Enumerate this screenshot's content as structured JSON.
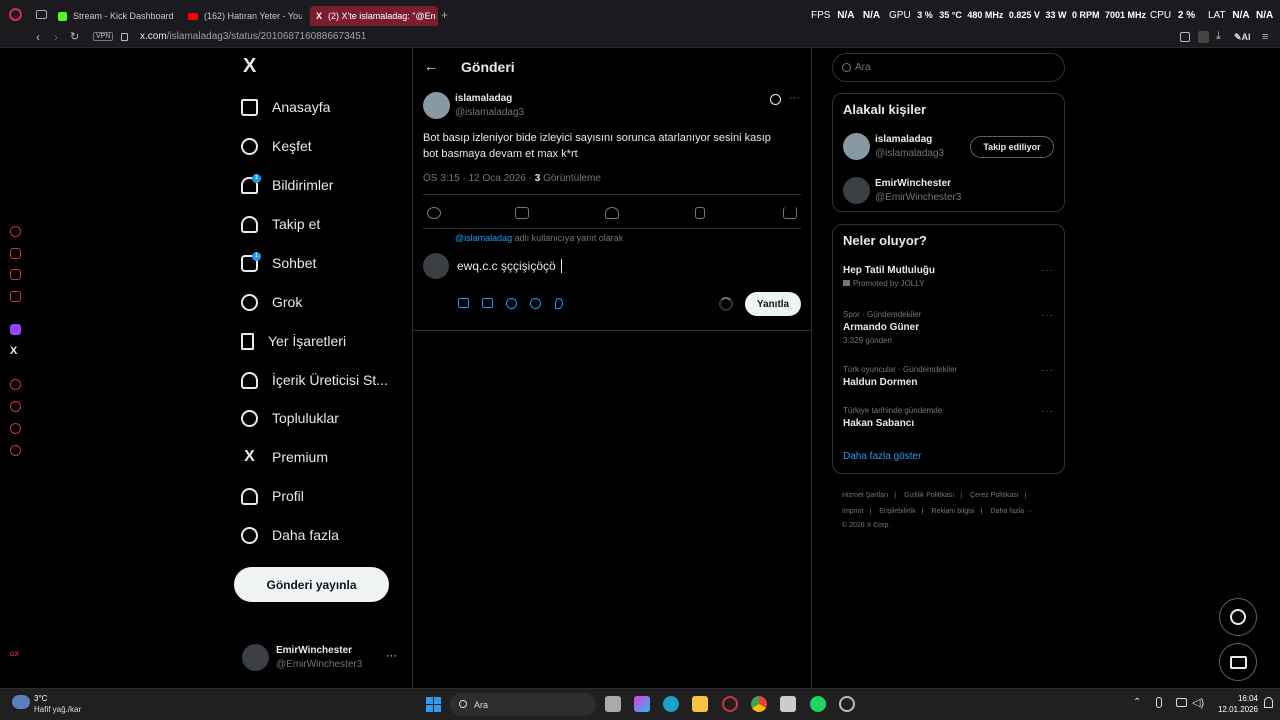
{
  "browser": {
    "tabs": [
      {
        "label": "Stream - Kick Dashboard"
      },
      {
        "label": "(162) Hatıran Yeter - YouTu"
      },
      {
        "label": "(2) X'te islamaladag: \"@En"
      }
    ],
    "vpn": "VPN",
    "url_host": "x.com",
    "url_path": "/islamaladag3/status/2010687160886673451",
    "ai_label": "AI",
    "hud": {
      "fps_label": "FPS",
      "fps1": "N/A",
      "fps2": "N/A",
      "gpu_label": "GPU",
      "gpu_load": "3 %",
      "gpu_temp": "35 °C",
      "gpu_clock": "480 MHz",
      "gpu_volt": "0.825 V",
      "gpu_power": "33 W",
      "gpu_fan": "0 RPM",
      "gpu_mem": "7001 MHz",
      "cpu_label": "CPU",
      "cpu_load": "2 %",
      "lat_label": "LAT",
      "lat1": "N/A",
      "lat2": "N/A"
    }
  },
  "nav": {
    "logo": "X",
    "items": [
      {
        "label": "Anasayfa"
      },
      {
        "label": "Keşfet"
      },
      {
        "label": "Bildirimler",
        "badge": "1"
      },
      {
        "label": "Takip et"
      },
      {
        "label": "Sohbet",
        "badge": "1"
      },
      {
        "label": "Grok"
      },
      {
        "label": "Yer İşaretleri"
      },
      {
        "label": "İçerik Üreticisi St..."
      },
      {
        "label": "Topluluklar"
      },
      {
        "label": "Premium"
      },
      {
        "label": "Profil"
      },
      {
        "label": "Daha fazla"
      }
    ],
    "post_button": "Gönderi yayınla",
    "account_name": "EmirWinchester",
    "account_handle": "@EmirWinchester3",
    "account_more": "···"
  },
  "post": {
    "header_title": "Gönderi",
    "author_name": "islamaladag",
    "author_handle": "@islamaladag3",
    "more": "···",
    "text_line1": "Bot basıp izleniyor bide izleyici sayısını sorunca atarlanıyor sesini kasıp",
    "text_line2": "bot basmaya devam et max k*rt",
    "time": "ÖS 3:15 · 12 Oca 2026 · ",
    "views_count": "3",
    "views_label": " Görüntüleme",
    "reply_to_handle": "@islamaladag",
    "reply_to_suffix": " adlı kullanıcıya yanıt olarak",
    "draft_text": "ewq.c.c şççişiçöçö",
    "reply_button": "Yanıtla"
  },
  "right": {
    "search_placeholder": "Ara",
    "related_title": "Alakalı kişiler",
    "related": [
      {
        "name": "islamaladag",
        "handle": "@islamaladag3",
        "button": "Takip ediliyor"
      },
      {
        "name": "EmirWinchester",
        "handle": "@EmirWinchester3"
      }
    ],
    "trends_title": "Neler oluyor?",
    "trends": [
      {
        "context": "",
        "title": "Hep Tatil Mutluluğu",
        "meta": "Promoted by JOLLY"
      },
      {
        "context": "Spor · Gündemdekiler",
        "title": "Armando Güner",
        "meta": "3.329 gönderi"
      },
      {
        "context": "Türk oyuncular · Gündemdekiler",
        "title": "Haldun Dormen",
        "meta": ""
      },
      {
        "context": "Türkiye tarihinde gündemde",
        "title": "Hakan Sabancı",
        "meta": ""
      }
    ],
    "show_more": "Daha fazla göster",
    "footer_row1": [
      "Hizmet Şartları",
      "Gizlilik Politikası",
      "Çerez Politikası"
    ],
    "footer_row2": [
      "Imprint",
      "Erişilebilirlik",
      "Reklam bilgisi",
      "Daha fazla ···"
    ],
    "copyright": "© 2026 X Corp."
  },
  "taskbar": {
    "temp": "3°C",
    "weather": "Hafif yağ./kar",
    "search": "Ara",
    "time": "16:04",
    "date": "12.01.2026"
  },
  "colors": {
    "accent": "#1d9bf0",
    "opera": "#d23048",
    "active_tab": "#7a1e2e"
  }
}
